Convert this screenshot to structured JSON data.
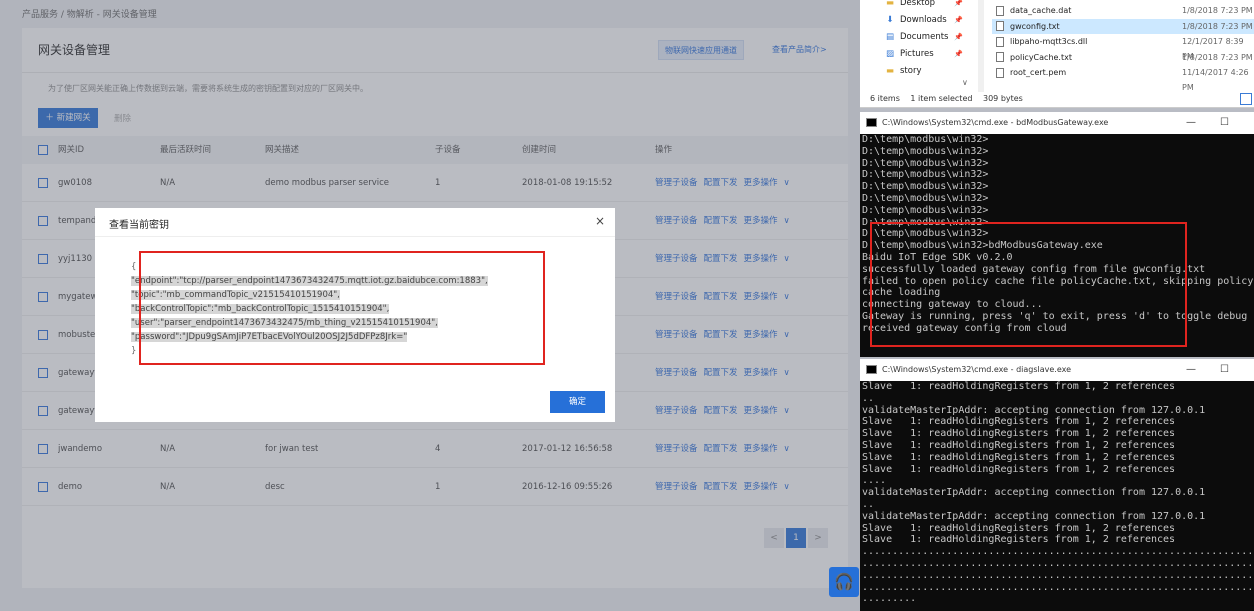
{
  "breadcrumb": "产品服务 / 物解析 - 网关设备管理",
  "page": {
    "title": "网关设备管理",
    "link_fast": "物联网快速应用通道",
    "link_intro": "查看产品简介>",
    "description": "为了使厂区网关能正确上传数据到云端，需要将系统生成的密钥配置到对应的厂区网关中。",
    "new_button": "新建网关",
    "delete_button": "删除"
  },
  "table": {
    "headers": [
      "网关ID",
      "最后活跃时间",
      "网关描述",
      "子设备",
      "创建时间",
      "操作"
    ],
    "rows": [
      {
        "id": "gw0108",
        "last": "N/A",
        "desc": "demo modbus parser service",
        "sub": "1",
        "created": "2018-01-08 19:15:52"
      },
      {
        "id": "tempandtl",
        "last": "",
        "desc": "",
        "sub": "",
        "created": ""
      },
      {
        "id": "yyj1130",
        "last": "",
        "desc": "",
        "sub": "",
        "created": ""
      },
      {
        "id": "mygatewa",
        "last": "",
        "desc": "",
        "sub": "",
        "created": ""
      },
      {
        "id": "mobustes",
        "last": "",
        "desc": "",
        "sub": "",
        "created": ""
      },
      {
        "id": "gatewayte",
        "last": "",
        "desc": "",
        "sub": "",
        "created": ""
      },
      {
        "id": "gatewayte",
        "last": "",
        "desc": "",
        "sub": "",
        "created": ""
      },
      {
        "id": "jwandemo",
        "last": "N/A",
        "desc": "for jwan test",
        "sub": "4",
        "created": "2017-01-12 16:56:58"
      },
      {
        "id": "demo",
        "last": "N/A",
        "desc": "desc",
        "sub": "1",
        "created": "2016-12-16 09:55:26"
      }
    ],
    "ops": {
      "manage": "管理子设备",
      "config": "配置下发",
      "more": "更多操作"
    }
  },
  "pagination": {
    "prev": "<",
    "current": "1",
    "next": ">"
  },
  "modal": {
    "title": "查看当前密钥",
    "close": "×",
    "open_brace": "{",
    "close_brace": "}",
    "lines": [
      "\"endpoint\":\"tcp://parser_endpoint1473673432475.mqtt.iot.gz.baidubce.com:1883\",",
      "\"topic\":\"mb_commandTopic_v21515410151904\",",
      "\"backControlTopic\":\"mb_backControlTopic_1515410151904\",",
      "\"user\":\"parser_endpoint1473673432475/mb_thing_v21515410151904\",",
      "\"password\":\"JDpu9gSAmJiP7ETbacEVolYOul20OSJ2J5dDFPz8Jrk=\""
    ],
    "confirm": "确定"
  },
  "explorer": {
    "nav": [
      {
        "icon": "folder",
        "label": "Desktop"
      },
      {
        "icon": "download",
        "label": "Downloads"
      },
      {
        "icon": "doc",
        "label": "Documents"
      },
      {
        "icon": "picture",
        "label": "Pictures"
      },
      {
        "icon": "folder",
        "label": "story"
      }
    ],
    "files": [
      {
        "name": "data_cache.dat",
        "date": "1/8/2018 7:23 PM"
      },
      {
        "name": "gwconfig.txt",
        "date": "1/8/2018 7:23 PM"
      },
      {
        "name": "libpaho-mqtt3cs.dll",
        "date": "12/1/2017 8:39 PM"
      },
      {
        "name": "policyCache.txt",
        "date": "1/8/2018 7:23 PM"
      },
      {
        "name": "root_cert.pem",
        "date": "11/14/2017 4:26 PM"
      }
    ],
    "status": {
      "items": "6 items",
      "selected": "1 item selected",
      "size": "309 bytes"
    }
  },
  "cmd1": {
    "title": "C:\\Windows\\System32\\cmd.exe - bdModbusGateway.exe",
    "lines": [
      "D:\\temp\\modbus\\win32>",
      "D:\\temp\\modbus\\win32>",
      "D:\\temp\\modbus\\win32>",
      "D:\\temp\\modbus\\win32>",
      "D:\\temp\\modbus\\win32>",
      "D:\\temp\\modbus\\win32>",
      "D:\\temp\\modbus\\win32>",
      "D:\\temp\\modbus\\win32>",
      "D:\\temp\\modbus\\win32>",
      "D:\\temp\\modbus\\win32>bdModbusGateway.exe",
      "Baidu IoT Edge SDK v0.2.0",
      "successfully loaded gateway config from file gwconfig.txt",
      "failed to open policy cache file policyCache.txt, skipping policy",
      "cache loading",
      "connecting gateway to cloud...",
      "Gateway is running, press 'q' to exit, press 'd' to toggle debug",
      "received gateway config from cloud"
    ]
  },
  "cmd2": {
    "title": "C:\\Windows\\System32\\cmd.exe - diagslave.exe",
    "lines": [
      "Slave   1: readHoldingRegisters from 1, 2 references",
      "..",
      "validateMasterIpAddr: accepting connection from 127.0.0.1",
      "Slave   1: readHoldingRegisters from 1, 2 references",
      "Slave   1: readHoldingRegisters from 1, 2 references",
      "Slave   1: readHoldingRegisters from 1, 2 references",
      "Slave   1: readHoldingRegisters from 1, 2 references",
      "Slave   1: readHoldingRegisters from 1, 2 references",
      "....",
      "validateMasterIpAddr: accepting connection from 127.0.0.1",
      "..",
      "validateMasterIpAddr: accepting connection from 127.0.0.1",
      "Slave   1: readHoldingRegisters from 1, 2 references",
      "Slave   1: readHoldingRegisters from 1, 2 references",
      "..................................................................",
      "..................................................................",
      "..................................................................",
      "..................................................................",
      "........."
    ]
  },
  "window_controls": {
    "minimize": "—",
    "maximize": "☐"
  }
}
